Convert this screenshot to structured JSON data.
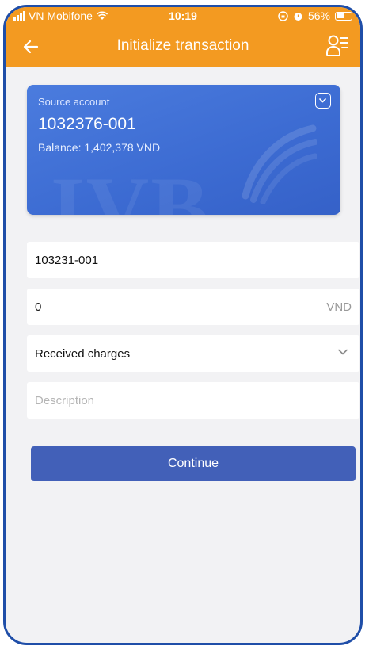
{
  "status_bar": {
    "carrier": "VN Mobifone",
    "time": "10:19",
    "battery": "56%"
  },
  "header": {
    "title": "Initialize transaction",
    "back_icon": "arrow-left-icon",
    "contact_icon": "contact-list-icon"
  },
  "source_card": {
    "label": "Source account",
    "account_number": "1032376-001",
    "balance": "Balance: 1,402,378 VND",
    "watermark": "IVB"
  },
  "form": {
    "beneficiary_account": "103231-001",
    "amount": "0",
    "currency": "VND",
    "charges": "Received charges",
    "description_placeholder": "Description"
  },
  "actions": {
    "continue_label": "Continue"
  },
  "colors": {
    "header": "#f39a21",
    "card": "#4b7cde",
    "button": "#4260b8",
    "background": "#f2f2f4"
  }
}
